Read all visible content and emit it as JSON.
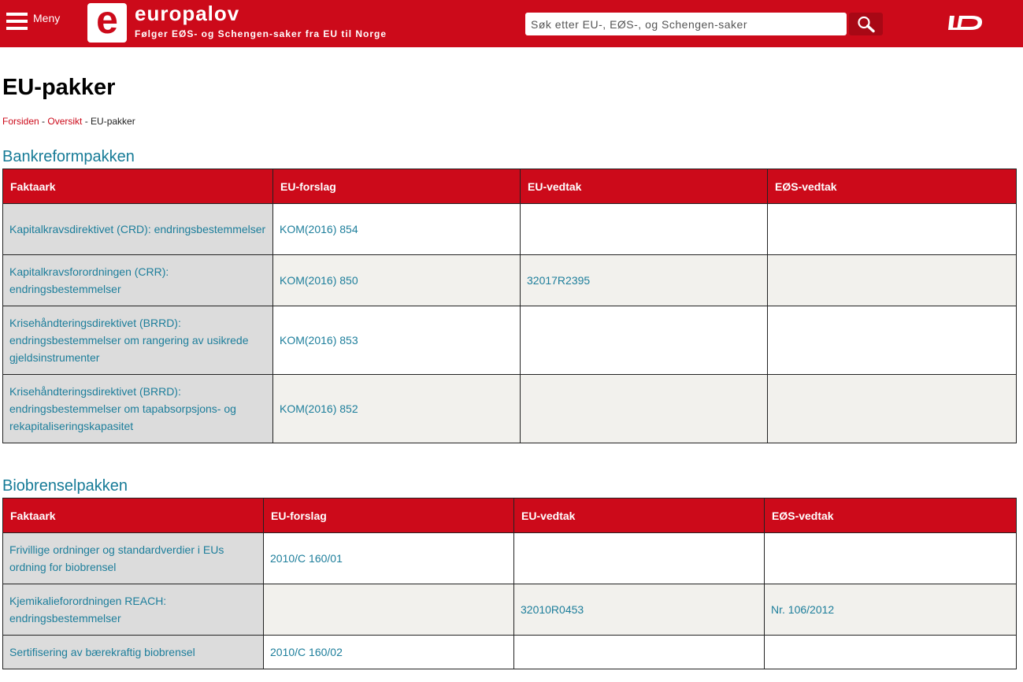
{
  "header": {
    "menu_label": "Meny",
    "logo_letter": "e",
    "site_name": "europalov",
    "tagline": "Følger EØS- og Schengen-saker fra EU til Norge",
    "search_placeholder": "Søk etter EU-, EØS-, og Schengen-saker",
    "brand_color": "#cc0a1a"
  },
  "page": {
    "title": "EU-pakker",
    "breadcrumb": [
      {
        "label": "Forsiden",
        "link": true
      },
      {
        "label": "Oversikt",
        "link": true
      },
      {
        "label": "EU-pakker",
        "link": false
      }
    ],
    "separator": " - "
  },
  "sections": [
    {
      "title": "Bankreformpakken",
      "columns": [
        "Faktaark",
        "EU-forslag",
        "EU-vedtak",
        "EØS-vedtak"
      ],
      "rows": [
        [
          "Kapitalkravsdirektivet (CRD): endringsbestemmelser",
          "KOM(2016) 854",
          "",
          ""
        ],
        [
          "Kapitalkravsforordningen (CRR): endringsbestemmelser",
          "KOM(2016) 850",
          "32017R2395",
          ""
        ],
        [
          "Krisehåndteringsdirektivet (BRRD): endringsbestemmelser om rangering av usikrede gjeldsinstrumenter",
          "KOM(2016) 853",
          "",
          ""
        ],
        [
          "Krisehåndteringsdirektivet (BRRD): endringsbestemmelser om tapabsorpsjons- og rekapitaliseringskapasitet",
          "KOM(2016) 852",
          "",
          ""
        ]
      ]
    },
    {
      "title": "Biobrenselpakken",
      "columns": [
        "Faktaark",
        "EU-forslag",
        "EU-vedtak",
        "EØS-vedtak"
      ],
      "rows": [
        [
          "Frivillige ordninger og standardverdier i EUs ordning for biobrensel",
          "2010/C 160/01",
          "",
          ""
        ],
        [
          "Kjemikalieforordningen REACH: endringsbestemmelser",
          "",
          "32010R0453",
          "Nr. 106/2012"
        ],
        [
          "Sertifisering av bærekraftig biobrensel",
          "2010/C 160/02",
          "",
          ""
        ]
      ]
    }
  ]
}
